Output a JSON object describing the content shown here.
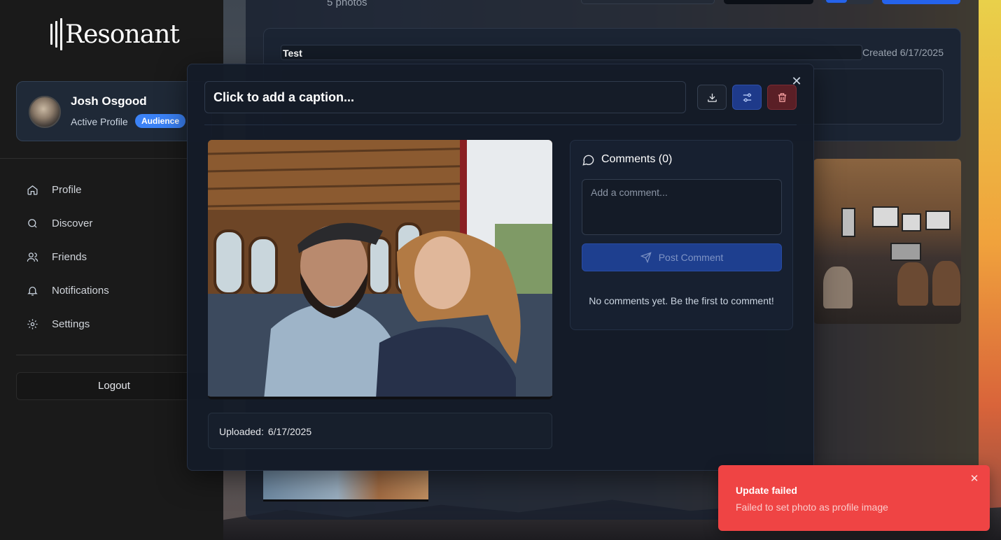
{
  "app": {
    "logo_text": "Resonant"
  },
  "sidebar": {
    "profile": {
      "name": "Josh Osgood",
      "subtitle": "Active Profile",
      "badge": "Audience"
    },
    "items": [
      {
        "label": "Profile",
        "icon": "home-icon"
      },
      {
        "label": "Discover",
        "icon": "search-icon"
      },
      {
        "label": "Friends",
        "icon": "users-icon"
      },
      {
        "label": "Notifications",
        "icon": "bell-icon"
      },
      {
        "label": "Settings",
        "icon": "gear-icon"
      }
    ],
    "logout_label": "Logout"
  },
  "album": {
    "photo_count": "5 photos",
    "title": "Test",
    "created": "Created 6/17/2025"
  },
  "modal": {
    "caption_placeholder": "Click to add a caption...",
    "uploaded_label": "Uploaded:",
    "uploaded_date": "6/17/2025",
    "comments": {
      "title": "Comments (0)",
      "placeholder": "Add a comment...",
      "post_label": "Post Comment",
      "empty_text": "No comments yet. Be the first to comment!"
    }
  },
  "toast": {
    "title": "Update failed",
    "message": "Failed to set photo as profile image"
  },
  "colors": {
    "accent": "#2563eb",
    "badge": "#3b82f6",
    "danger": "#ef4444",
    "sidebar_bg": "#1a1a1a",
    "modal_bg": "#141b28"
  }
}
